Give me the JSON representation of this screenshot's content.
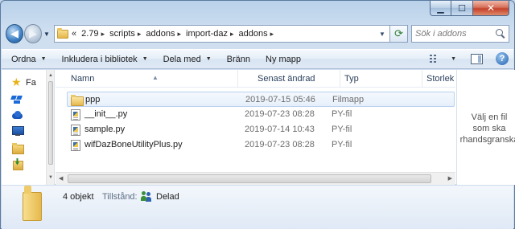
{
  "window": {
    "minimize_glyph": "▁",
    "maximize_glyph": "☐",
    "close_glyph": "✕"
  },
  "address": {
    "overflow": "«",
    "crumbs": [
      "2.79",
      "scripts",
      "addons",
      "import-daz",
      "addons"
    ],
    "separator": "▸"
  },
  "search": {
    "placeholder": "Sök i addons"
  },
  "toolbar": {
    "organize": "Ordna",
    "include_in_library": "Inkludera i bibliotek",
    "share_with": "Dela med",
    "burn": "Bränn",
    "new_folder": "Ny mapp",
    "help_glyph": "?"
  },
  "nav_pane": {
    "items": [
      {
        "icon": "star-icon",
        "label": "Fa"
      },
      {
        "icon": "dropbox-icon",
        "label": ""
      },
      {
        "icon": "onedrive-icon",
        "label": ""
      },
      {
        "icon": "desktop-icon",
        "label": ""
      },
      {
        "icon": "folder-icon",
        "label": ""
      },
      {
        "icon": "download-folder-icon",
        "label": ""
      }
    ]
  },
  "columns": {
    "name": "Namn",
    "date": "Senast ändrad",
    "type": "Typ",
    "size": "Storlek"
  },
  "files": [
    {
      "name": "ppp",
      "date": "2019-07-15 05:46",
      "type": "Filmapp",
      "icon": "folder-icon"
    },
    {
      "name": "__init__.py",
      "date": "2019-07-23 08:28",
      "type": "PY-fil",
      "icon": "python-file-icon"
    },
    {
      "name": "sample.py",
      "date": "2019-07-14 10:43",
      "type": "PY-fil",
      "icon": "python-file-icon"
    },
    {
      "name": "wifDazBoneUtilityPlus.py",
      "date": "2019-07-23 08:28",
      "type": "PY-fil",
      "icon": "python-file-icon"
    }
  ],
  "preview_pane": {
    "line1": "Välj en fil",
    "line2": "som ska",
    "line3": "rhandsgranska"
  },
  "details": {
    "count": "4 objekt",
    "status_label": "Tillstånd:",
    "status_value": "Delad"
  }
}
